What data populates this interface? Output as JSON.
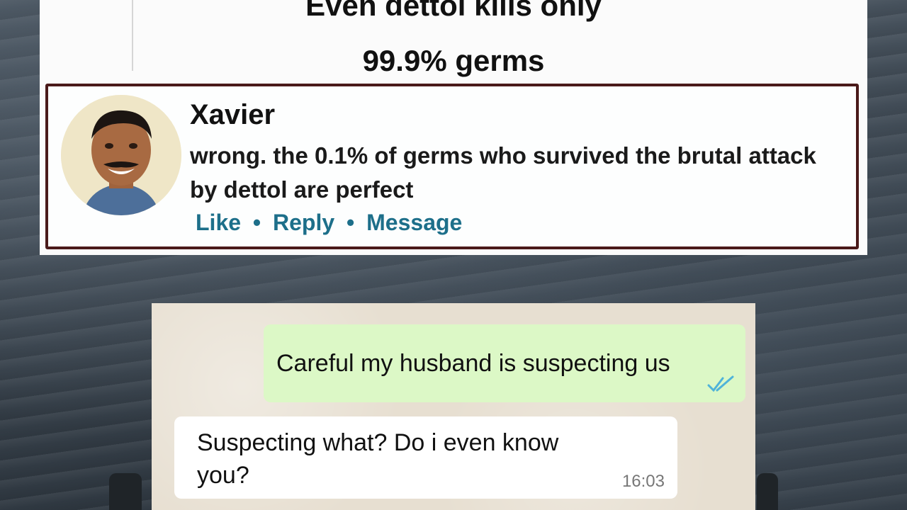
{
  "post": {
    "line1": "Even dettol kills only",
    "line2": "99.9% germs"
  },
  "comment": {
    "author": "Xavier",
    "text": "wrong. the 0.1% of germs who survived the brutal attack by dettol are perfect",
    "actions": {
      "like": "Like",
      "reply": "Reply",
      "message": "Message",
      "separator": "•"
    },
    "avatar_icon": "user-avatar"
  },
  "chat": {
    "outgoing": {
      "text": "Careful my husband is suspecting us",
      "status_icon": "double-check-icon",
      "status_color": "#4fb3d9"
    },
    "incoming": {
      "text": "Suspecting what? Do i even know you?",
      "time": "16:03"
    }
  },
  "colors": {
    "link": "#1d6f8a",
    "outgoing_bubble": "#dcf8c6",
    "comment_border": "#4a1a1a"
  }
}
